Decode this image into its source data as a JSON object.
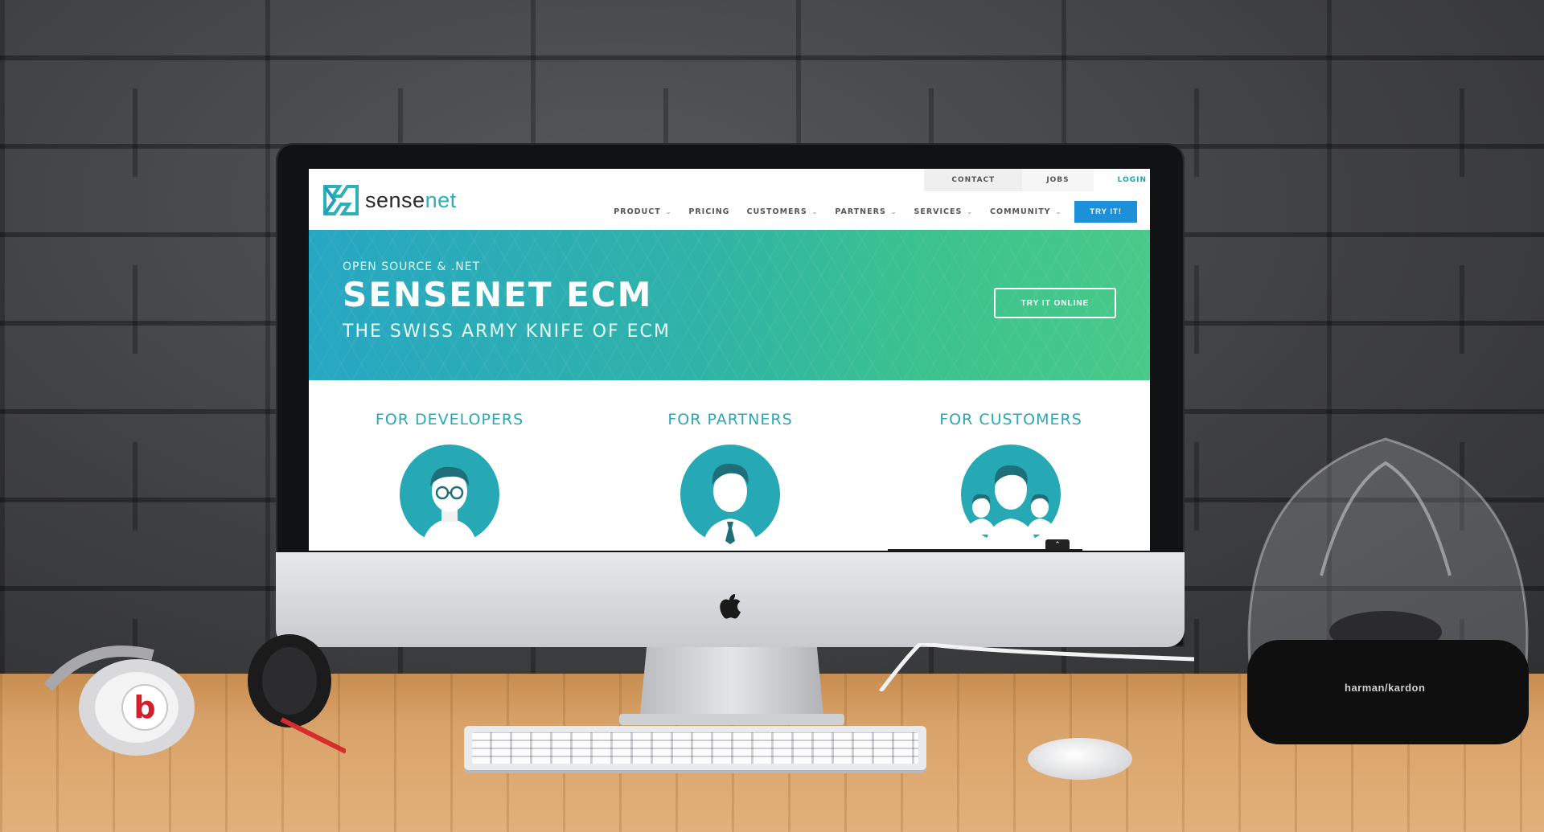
{
  "site": {
    "brand": {
      "name_part1": "sense",
      "name_part2": "net"
    },
    "top_links": {
      "contact": "CONTACT",
      "jobs": "JOBS",
      "login": "LOGIN"
    },
    "nav": [
      {
        "label": "PRODUCT",
        "dropdown": true
      },
      {
        "label": "PRICING",
        "dropdown": false
      },
      {
        "label": "CUSTOMERS",
        "dropdown": true
      },
      {
        "label": "PARTNERS",
        "dropdown": true
      },
      {
        "label": "SERVICES",
        "dropdown": true
      },
      {
        "label": "COMMUNITY",
        "dropdown": true
      }
    ],
    "nav_chevron": "⌄",
    "try_button": "TRY IT!",
    "hero": {
      "eyebrow": "OPEN SOURCE & .NET",
      "title": "SENSENET ECM",
      "subtitle": "THE SWISS ARMY KNIFE OF ECM",
      "cta": "TRY IT ONLINE"
    },
    "audiences": [
      {
        "title": "FOR DEVELOPERS",
        "icon": "developer-avatar-icon"
      },
      {
        "title": "FOR PARTNERS",
        "icon": "partner-avatar-icon"
      },
      {
        "title": "FOR CUSTOMERS",
        "icon": "customers-group-avatar-icon"
      }
    ],
    "scroll_top": "⌃"
  },
  "scene": {
    "apple_logo": "",
    "speaker_brand": "harman/kardon"
  },
  "colors": {
    "accent_teal": "#27a8b5",
    "hero_start": "#27a7c3",
    "hero_end": "#49c98a",
    "button_blue": "#1e90d8"
  }
}
